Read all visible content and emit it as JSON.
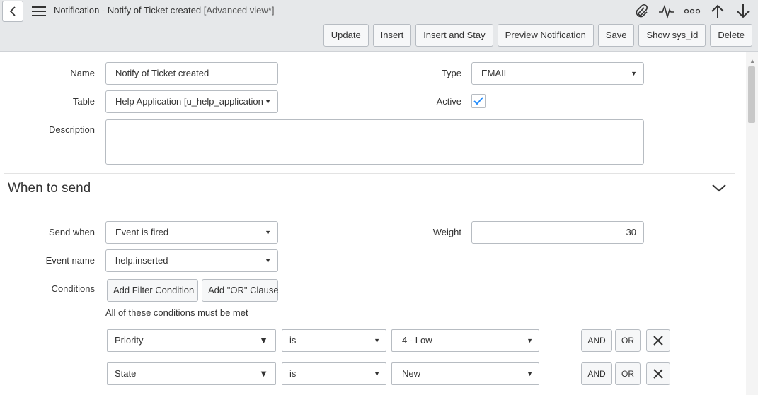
{
  "header": {
    "title": "Notification - Notify of Ticket created",
    "view": "[Advanced view*]",
    "icons": [
      "back-icon",
      "menu-icon",
      "paperclip-icon",
      "activity-icon",
      "more-icon",
      "arrow-up-icon",
      "arrow-down-icon"
    ],
    "buttons": {
      "update": "Update",
      "insert": "Insert",
      "insert_and_stay": "Insert and Stay",
      "preview": "Preview Notification",
      "save": "Save",
      "show_sys_id": "Show sys_id",
      "delete": "Delete"
    }
  },
  "form": {
    "name_label": "Name",
    "name_value": "Notify of Ticket created",
    "table_label": "Table",
    "table_value": "Help Application [u_help_application",
    "description_label": "Description",
    "type_label": "Type",
    "type_value": "EMAIL",
    "active_label": "Active",
    "active_checked": true
  },
  "when_to_send": {
    "title": "When to send",
    "send_when_label": "Send when",
    "send_when_value": "Event is fired",
    "event_name_label": "Event name",
    "event_name_value": "help.inserted",
    "weight_label": "Weight",
    "weight_value": "30",
    "conditions_label": "Conditions",
    "add_filter_label": "Add Filter Condition",
    "add_or_label": "Add \"OR\" Clause",
    "conditions_note": "All of these conditions must be met",
    "conditions": [
      {
        "field": "Priority",
        "operator": "is",
        "value": "4 - Low",
        "and": "AND",
        "or": "OR"
      },
      {
        "field": "State",
        "operator": "is",
        "value": "New",
        "and": "AND",
        "or": "OR"
      }
    ]
  },
  "colors": {
    "header_bg": "#e6e8ea",
    "checkmark": "#278efc"
  }
}
